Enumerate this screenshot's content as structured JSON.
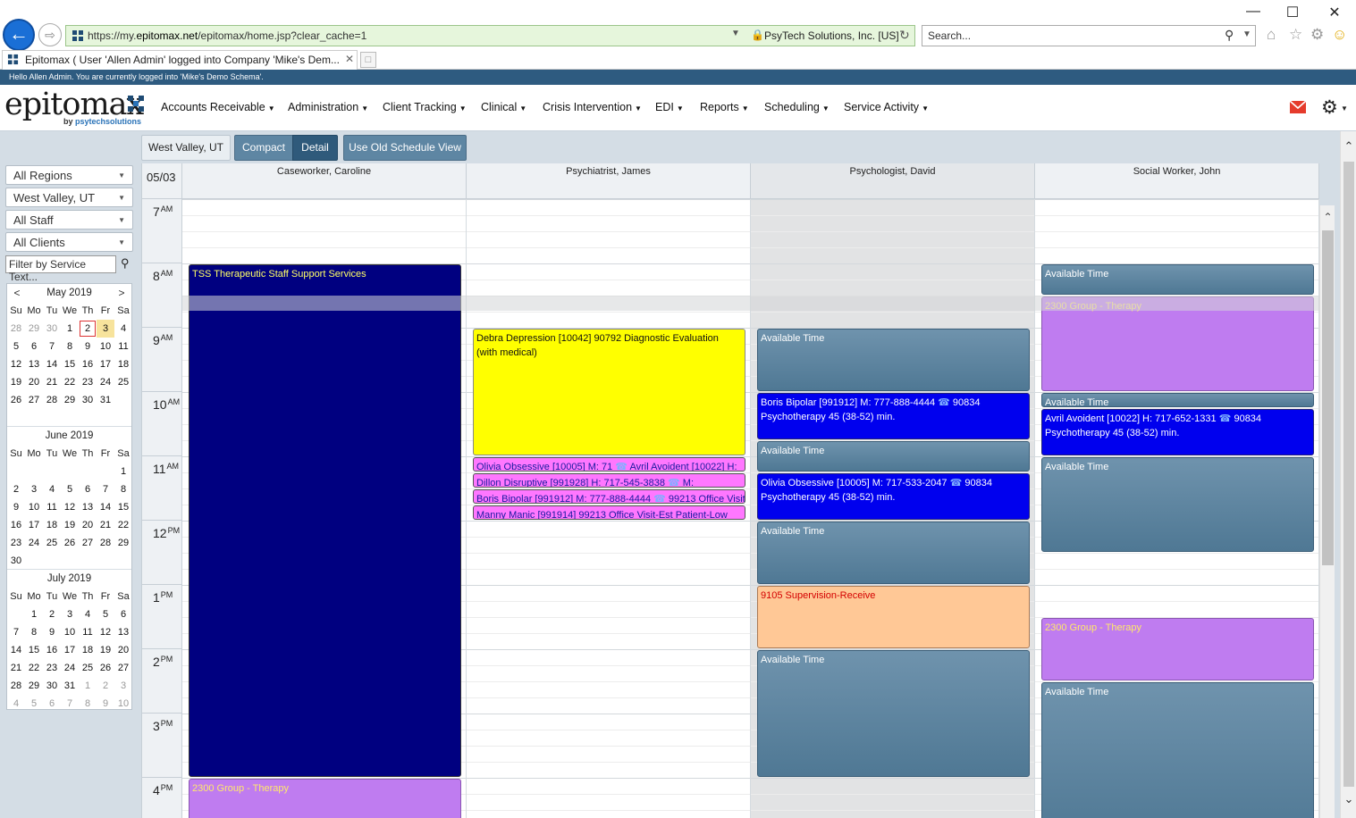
{
  "browser": {
    "url_scheme": "https://my.",
    "url_host": "epitomax.net",
    "url_path": "/epitomax/home.jsp?clear_cache=1",
    "cert_owner": "PsyTech Solutions, Inc. [US]",
    "search_placeholder": "Search...",
    "tab_title": "Epitomax ( User 'Allen Admin' logged into Company 'Mike's Dem...",
    "window_controls": {
      "minimize": "—",
      "maximize": "☐",
      "close": "✕"
    }
  },
  "app": {
    "welcome_text": "Hello Allen Admin. You are currently logged into 'Mike's Demo Schema'.",
    "logo_word": "epitomax",
    "logo_sub_prefix": "by ",
    "logo_sub_brand": "psytechsolutions",
    "menu": [
      "Accounts Receivable",
      "Administration",
      "Client Tracking",
      "Clinical",
      "Crisis Intervention",
      "EDI",
      "Reports",
      "Scheduling",
      "Service Activity"
    ]
  },
  "toolbar": {
    "location": "West Valley, UT",
    "compact": "Compact",
    "detail": "Detail",
    "old_view": "Use Old Schedule View"
  },
  "filters": {
    "region": "All Regions",
    "location": "West Valley, UT",
    "staff": "All Staff",
    "clients": "All Clients",
    "service_placeholder": "Filter by Service Text..."
  },
  "calendars": [
    {
      "label": "May 2019",
      "prev": "<",
      "next": ">",
      "dow": [
        "Su",
        "Mo",
        "Tu",
        "We",
        "Th",
        "Fr",
        "Sa"
      ],
      "days": [
        "28",
        "29",
        "30",
        "1",
        "2",
        "3",
        "4",
        "5",
        "6",
        "7",
        "8",
        "9",
        "10",
        "11",
        "12",
        "13",
        "14",
        "15",
        "16",
        "17",
        "18",
        "19",
        "20",
        "21",
        "22",
        "23",
        "24",
        "25",
        "26",
        "27",
        "28",
        "29",
        "30",
        "31",
        ""
      ],
      "other": [
        0,
        1,
        2
      ],
      "today_index": 4,
      "selected_index": 5
    },
    {
      "label": "June 2019",
      "dow": [
        "Su",
        "Mo",
        "Tu",
        "We",
        "Th",
        "Fr",
        "Sa"
      ],
      "days": [
        "",
        "",
        "",
        "",
        "",
        "",
        "1",
        "2",
        "3",
        "4",
        "5",
        "6",
        "7",
        "8",
        "9",
        "10",
        "11",
        "12",
        "13",
        "14",
        "15",
        "16",
        "17",
        "18",
        "19",
        "20",
        "21",
        "22",
        "23",
        "24",
        "25",
        "26",
        "27",
        "28",
        "29",
        "30",
        "",
        "",
        "",
        "",
        "",
        ""
      ],
      "other": []
    },
    {
      "label": "July 2019",
      "dow": [
        "Su",
        "Mo",
        "Tu",
        "We",
        "Th",
        "Fr",
        "Sa"
      ],
      "days": [
        "",
        "1",
        "2",
        "3",
        "4",
        "5",
        "6",
        "7",
        "8",
        "9",
        "10",
        "11",
        "12",
        "13",
        "14",
        "15",
        "16",
        "17",
        "18",
        "19",
        "20",
        "21",
        "22",
        "23",
        "24",
        "25",
        "26",
        "27",
        "28",
        "29",
        "30",
        "31",
        "1",
        "2",
        "3",
        "4",
        "5",
        "6",
        "7",
        "8",
        "9",
        "10"
      ],
      "other": [
        32,
        33,
        34,
        35,
        36,
        37,
        38,
        39,
        40,
        41
      ]
    }
  ],
  "schedule": {
    "date": "05/03",
    "hours": [
      {
        "num": "7",
        "ampm": "AM"
      },
      {
        "num": "8",
        "ampm": "AM"
      },
      {
        "num": "9",
        "ampm": "AM"
      },
      {
        "num": "10",
        "ampm": "AM"
      },
      {
        "num": "11",
        "ampm": "AM"
      },
      {
        "num": "12",
        "ampm": "PM"
      },
      {
        "num": "1",
        "ampm": "PM"
      },
      {
        "num": "2",
        "ampm": "PM"
      },
      {
        "num": "3",
        "ampm": "PM"
      },
      {
        "num": "4",
        "ampm": "PM"
      }
    ],
    "staff": [
      {
        "name": "Caseworker, Caroline",
        "appointments": [
          {
            "style": "navy",
            "start": "8:00",
            "end": "16:00",
            "text": "TSS Therapeutic Staff Support Services"
          },
          {
            "style": "group",
            "start": "16:00",
            "end": "17:00",
            "text": "2300 Group - Therapy"
          }
        ]
      },
      {
        "name": "Psychiatrist, James",
        "appointments": [
          {
            "style": "yellow",
            "start": "9:00",
            "end": "11:00",
            "text": "Debra Depression [10042] 90792 Diagnostic Evaluation (with medical)"
          },
          {
            "style": "pink",
            "start": "11:00",
            "end": "11:15",
            "text": "Olivia Obsessive [10005] M: 71",
            "text2": "Avril Avoident [10022] H:"
          },
          {
            "style": "pink",
            "start": "11:15",
            "end": "11:30",
            "text": "Dillon Disruptive [991928] H: 717-545-3838",
            "text2": "M:"
          },
          {
            "style": "pink",
            "start": "11:30",
            "end": "11:45",
            "text": "Boris Bipolar [991912] M: 777-888-4444",
            "text2": "99213 Office Visit-"
          },
          {
            "style": "pink",
            "start": "11:45",
            "end": "12:00",
            "text": "Manny Manic [991914] 99213 Office Visit-Est Patient-Low"
          }
        ]
      },
      {
        "name": "Psychologist, David",
        "appointments": [
          {
            "style": "avail",
            "start": "9:00",
            "end": "10:00",
            "text": "Available Time"
          },
          {
            "style": "blue",
            "start": "10:00",
            "end": "10:45",
            "text": "Boris Bipolar [991912] M: 777-888-4444",
            "text2": "90834",
            "text3": "Psychotherapy 45 (38-52) min."
          },
          {
            "style": "avail",
            "start": "10:45",
            "end": "11:15",
            "text": "Available Time"
          },
          {
            "style": "blue",
            "start": "11:15",
            "end": "12:00",
            "text": "Olivia Obsessive [10005] M: 717-533-2047",
            "text2": "90834",
            "text3": "Psychotherapy 45 (38-52) min."
          },
          {
            "style": "avail",
            "start": "12:00",
            "end": "13:00",
            "text": "Available Time"
          },
          {
            "style": "peach",
            "start": "13:00",
            "end": "14:00",
            "text": "9105 Supervision-Receive"
          },
          {
            "style": "avail",
            "start": "14:00",
            "end": "16:00",
            "text": "Available Time"
          }
        ]
      },
      {
        "name": "Social Worker, John",
        "appointments": [
          {
            "style": "avail",
            "start": "8:00",
            "end": "8:30",
            "text": "Available Time"
          },
          {
            "style": "group",
            "start": "8:30",
            "end": "10:00",
            "text": "2300 Group - Therapy"
          },
          {
            "style": "avail",
            "start": "10:00",
            "end": "10:15",
            "text": "Available Time"
          },
          {
            "style": "blue",
            "start": "10:15",
            "end": "11:00",
            "text": "Avril Avoident [10022] H: 717-652-1331",
            "text2": "90834",
            "text3": "Psychotherapy 45 (38-52) min."
          },
          {
            "style": "avail",
            "start": "11:00",
            "end": "12:30",
            "text": "Available Time"
          },
          {
            "style": "group",
            "start": "13:30",
            "end": "14:30",
            "text": "2300 Group - Therapy"
          },
          {
            "style": "avail",
            "start": "14:30",
            "end": "17:00",
            "text": "Available Time"
          }
        ]
      }
    ]
  },
  "colors": {
    "accent": "#2e5b80",
    "navy_block": "#000080",
    "available": "#5a829e",
    "group": "#bf7cf0",
    "psychotherapy": "#0000ee",
    "diagnostic": "#ffff00",
    "office_visit": "#ff77ff",
    "supervision": "#ffc896"
  }
}
